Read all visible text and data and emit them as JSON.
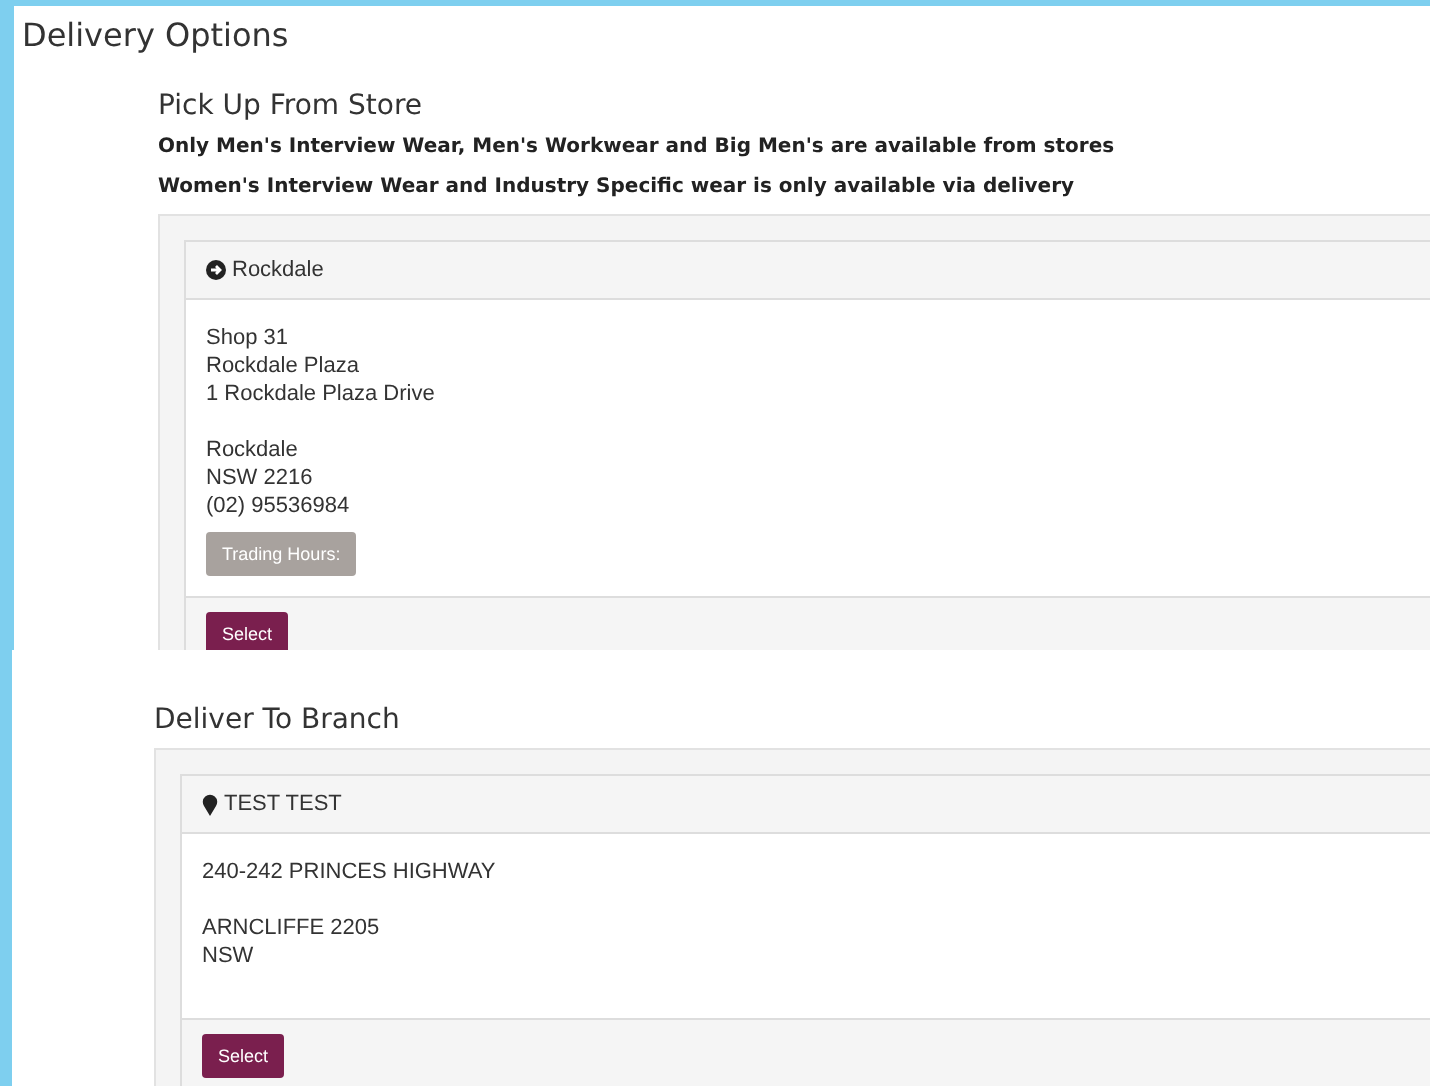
{
  "page_title": "Delivery Options",
  "sections": [
    {
      "kind": "pickup",
      "heading": "Pick Up From Store",
      "notes": [
        "Only Men's Interview Wear, Men's Workwear and Big Men's are available from stores",
        "Women's Interview Wear and Industry Specific wear is only available via delivery"
      ],
      "locations": [
        {
          "name": "Rockdale",
          "address_lines": [
            "Shop 31",
            "Rockdale Plaza",
            "1 Rockdale Plaza Drive"
          ],
          "locality_lines": [
            "Rockdale",
            "NSW 2216",
            "(02) 95536984"
          ],
          "hours_button": "Trading Hours:",
          "select_button": "Select"
        }
      ]
    },
    {
      "kind": "branch",
      "heading": "Deliver To Branch",
      "locations": [
        {
          "name": "TEST TEST",
          "address_lines": [
            "240-242 PRINCES HIGHWAY"
          ],
          "locality_lines": [
            "ARNCLIFFE 2205",
            "NSW"
          ],
          "select_button": "Select"
        }
      ]
    }
  ]
}
